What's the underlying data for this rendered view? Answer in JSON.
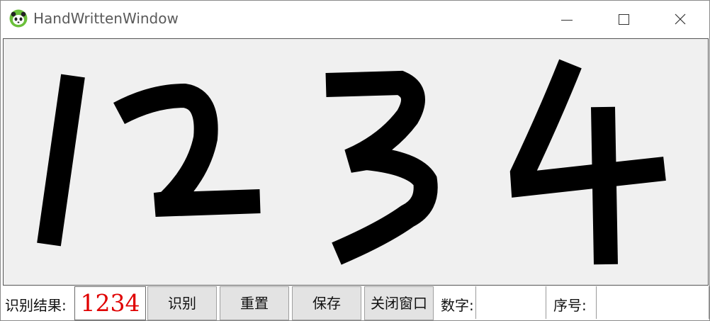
{
  "window": {
    "title": "HandWrittenWindow",
    "icon": "panda-icon"
  },
  "canvas": {
    "content": "handwritten digits 1 2 3 4",
    "stroke_color": "#000000",
    "background": "#f0f0f0"
  },
  "controls": {
    "result_label": "识别结果:",
    "result_value": "1234",
    "result_color": "#e00000",
    "recognize_button": "识别",
    "reset_button": "重置",
    "save_button": "保存",
    "close_button": "关闭窗口",
    "digit_label": "数字:",
    "digit_value": "",
    "index_label": "序号:",
    "index_value": ""
  }
}
